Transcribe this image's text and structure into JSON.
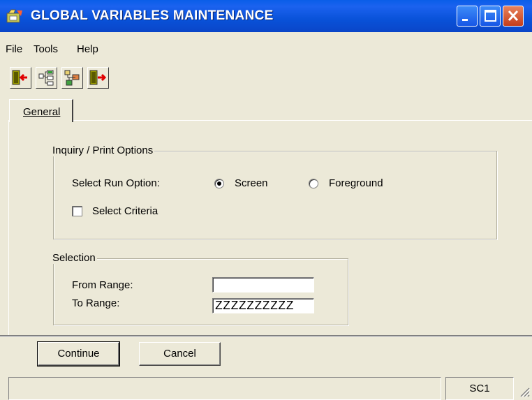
{
  "window": {
    "title": "GLOBAL VARIABLES MAINTENANCE",
    "minimize_icon": "minimize-icon",
    "maximize_icon": "maximize-icon",
    "close_icon": "close-icon"
  },
  "menu": {
    "items": [
      "File",
      "Tools",
      "Help"
    ]
  },
  "toolbar": {
    "buttons": [
      {
        "name": "exit-door-icon"
      },
      {
        "name": "tree-icon"
      },
      {
        "name": "network-icon"
      },
      {
        "name": "enter-door-icon"
      }
    ]
  },
  "tabs": [
    {
      "label": "General",
      "selected": true
    }
  ],
  "inquiry": {
    "title": "Inquiry / Print Options",
    "run_option_label": "Select Run Option:",
    "radio_screen": "Screen",
    "radio_foreground": "Foreground",
    "selected_option": "Screen",
    "select_criteria_label": "Select Criteria",
    "select_criteria_checked": false
  },
  "selection": {
    "title": "Selection",
    "from_label": "From Range:",
    "from_value": "",
    "to_label": "To Range:",
    "to_value": "ZZZZZZZZZZ"
  },
  "buttons": {
    "continue_label": "Continue",
    "cancel_label": "Cancel"
  },
  "status": {
    "pane1": "",
    "pane2": "SC1"
  }
}
